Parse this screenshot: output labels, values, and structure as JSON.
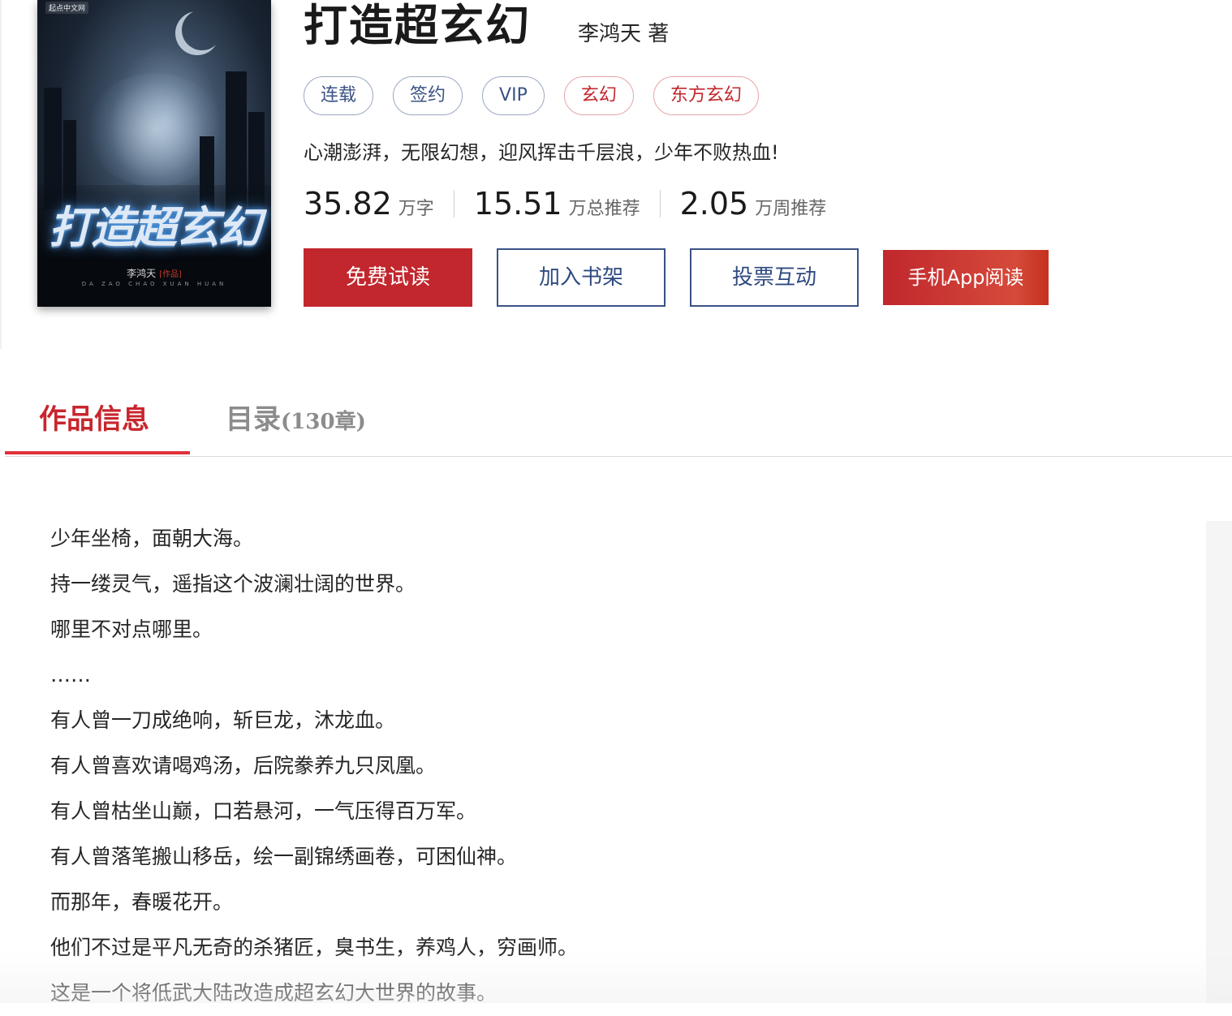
{
  "book": {
    "title": "打造超玄幻",
    "author": "李鸿天 著",
    "intro": "心潮澎湃，无限幻想，迎风挥击千层浪，少年不败热血!",
    "tags": [
      {
        "label": "连载",
        "color": "blue"
      },
      {
        "label": "签约",
        "color": "blue"
      },
      {
        "label": "VIP",
        "color": "blue"
      },
      {
        "label": "玄幻",
        "color": "red"
      },
      {
        "label": "东方玄幻",
        "color": "red"
      }
    ],
    "stats": [
      {
        "value": "35.82",
        "unit": "万字"
      },
      {
        "value": "15.51",
        "unit": "万总推荐"
      },
      {
        "value": "2.05",
        "unit": "万周推荐"
      }
    ]
  },
  "cover": {
    "publisher": "起点中文网",
    "title": "打造超玄幻",
    "author": "李鸿天",
    "author_tag": "[作品]",
    "pinyin": "DA ZAO CHAO XUAN HUAN"
  },
  "actions": {
    "free_read": "免费试读",
    "add_shelf": "加入书架",
    "vote": "投票互动",
    "app_read": "手机App阅读"
  },
  "tabs": {
    "info": "作品信息",
    "catalog": "目录",
    "catalog_count": "(130章)"
  },
  "description": [
    "少年坐椅，面朝大海。",
    "持一缕灵气，遥指这个波澜壮阔的世界。",
    "哪里不对点哪里。",
    "……",
    "有人曾一刀成绝响，斩巨龙，沐龙血。",
    "有人曾喜欢请喝鸡汤，后院豢养九只凤凰。",
    "有人曾枯坐山巅，口若悬河，一气压得百万军。",
    "有人曾落笔搬山移岳，绘一副锦绣画卷，可困仙神。",
    "而那年，春暖花开。",
    "他们不过是平凡无奇的杀猪匠，臭书生，养鸡人，穷画师。",
    "这是一个将低武大陆改造成超玄幻大世界的故事。"
  ],
  "colors": {
    "accent_red": "#c1272d",
    "tag_blue": "#3a5285",
    "tab_underline": "#e0303a"
  }
}
